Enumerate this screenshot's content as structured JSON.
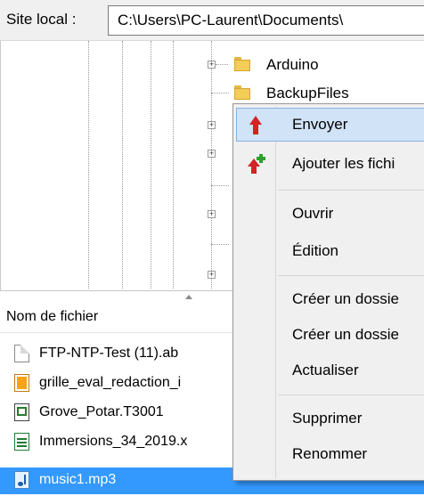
{
  "site_bar": {
    "label": "Site local :",
    "path": "C:\\Users\\PC-Laurent\\Documents\\"
  },
  "tree": {
    "folders": [
      "Arduino",
      "BackupFiles"
    ]
  },
  "file_list": {
    "column_name": "Nom de fichier",
    "files": [
      {
        "name": "FTP-NTP-Test (11).ab",
        "icon": "document-icon"
      },
      {
        "name": "grille_eval_redaction_i",
        "icon": "pdf-icon"
      },
      {
        "name": "Grove_Potar.T3001",
        "icon": "application-icon"
      },
      {
        "name": "Immersions_34_2019.x",
        "icon": "spreadsheet-icon"
      },
      {
        "name": "music1.mp3",
        "icon": "audio-file-icon",
        "selected": true
      }
    ]
  },
  "context_menu": {
    "items": [
      {
        "label": "Envoyer",
        "icon": "upload-arrow-icon",
        "highlighted": true
      },
      {
        "label": "Ajouter les fichi",
        "icon": "add-to-queue-icon"
      },
      {
        "label": "Ouvrir"
      },
      {
        "label": "Édition"
      },
      {
        "label": "Créer un dossie"
      },
      {
        "label": "Créer un dossie"
      },
      {
        "label": "Actualiser"
      },
      {
        "label": "Supprimer"
      },
      {
        "label": "Renommer"
      }
    ]
  },
  "colors": {
    "selection": "#3399ff",
    "menu_highlight": "#d1e3f6",
    "menu_background": "#f0f0f0"
  }
}
